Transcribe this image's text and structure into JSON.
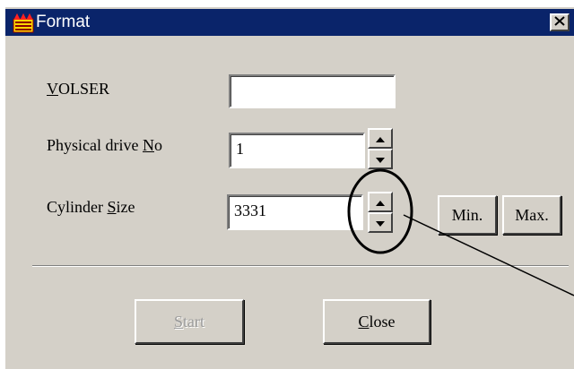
{
  "window": {
    "title": "Format",
    "close_symbol": "✕"
  },
  "fields": {
    "volser": {
      "label_prefix": "",
      "label_accel": "V",
      "label_suffix": "OLSER",
      "value": ""
    },
    "physical_drive": {
      "label_prefix": "Physical drive ",
      "label_accel": "N",
      "label_suffix": "o",
      "value": "1"
    },
    "cylinder_size": {
      "label_prefix": "Cylinder ",
      "label_accel": "S",
      "label_suffix": "ize",
      "value": "3331"
    }
  },
  "buttons": {
    "min_label": "Min.",
    "max_label": "Max.",
    "start": {
      "accel": "S",
      "rest": "tart",
      "enabled": false
    },
    "close": {
      "accel": "C",
      "rest": "lose",
      "enabled": true
    }
  },
  "icons": {
    "app": "format-app-icon",
    "close": "close-icon",
    "spin_up": "arrow-up-icon",
    "spin_down": "arrow-down-icon"
  },
  "colors": {
    "titlebar": "#0a246a",
    "face": "#d4d0c8",
    "annotation": "#000000"
  }
}
